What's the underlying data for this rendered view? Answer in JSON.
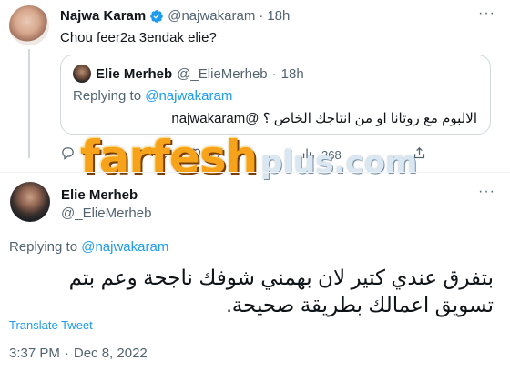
{
  "tweet1": {
    "author_name": "Najwa Karam",
    "handle": "@najwakaram",
    "separator": "·",
    "time": "18h",
    "text": "Chou feer2a 3endak elie?",
    "more": "···"
  },
  "quote": {
    "author_name": "Elie Merheb",
    "handle": "@_ElieMerheb",
    "separator": "·",
    "time": "18h",
    "replying_prefix": "Replying to",
    "replying_mention": "@najwakaram",
    "text": "الالبوم مع روتانا او من انتاجك الخاص ؟ @najwakaram"
  },
  "actions1": {
    "reply_count": "",
    "retweet_count": "",
    "like_count": "27",
    "views_count": "368"
  },
  "watermark": {
    "main": "farfesh",
    "sub": "plus.com"
  },
  "tweet2": {
    "author_name": "Elie Merheb",
    "handle": "@_ElieMerheb",
    "more": "···",
    "replying_prefix": "Replying to",
    "replying_mention": "@najwakaram",
    "text": "بتفرق عندي كتير لان بهمني شوفك ناجحة وعم بتم تسويق اعمالك بطريقة صحيحة.",
    "translate_label": "Translate Tweet",
    "time": "3:37 PM",
    "separator": "·",
    "date": "Dec 8, 2022"
  },
  "colors": {
    "link": "#1d9bf0",
    "secondary_text": "#536471",
    "primary_text": "#0f1419",
    "border": "#cfd9de",
    "watermark": "#f6a31b"
  },
  "icons": [
    "verified-badge-icon",
    "reply-icon",
    "retweet-icon",
    "like-icon",
    "views-icon",
    "share-icon",
    "more-icon"
  ]
}
